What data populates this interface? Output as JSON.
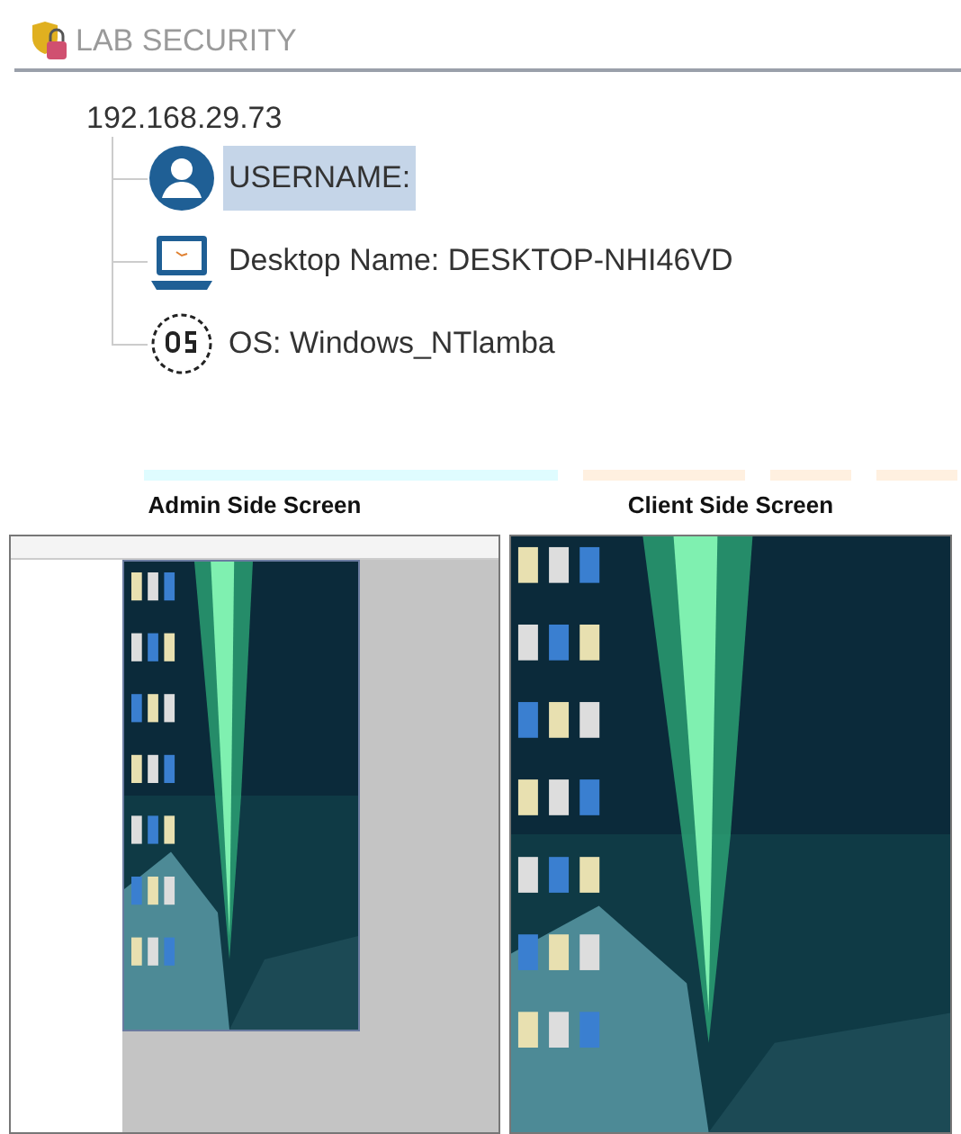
{
  "header": {
    "title": "LAB SECURITY"
  },
  "tree": {
    "label": "192.168.29.73",
    "children": [
      {
        "kind": "user",
        "label": "USERNAME:",
        "selected": true
      },
      {
        "kind": "desktop",
        "label": "Desktop Name: DESKTOP-NHI46VD",
        "selected": false
      },
      {
        "kind": "os",
        "label": "OS: Windows_NTlamba",
        "selected": false
      }
    ]
  },
  "screens": [
    {
      "kind": "admin",
      "title": "Admin Side Screen"
    },
    {
      "kind": "client",
      "title": "Client Side Screen"
    }
  ]
}
